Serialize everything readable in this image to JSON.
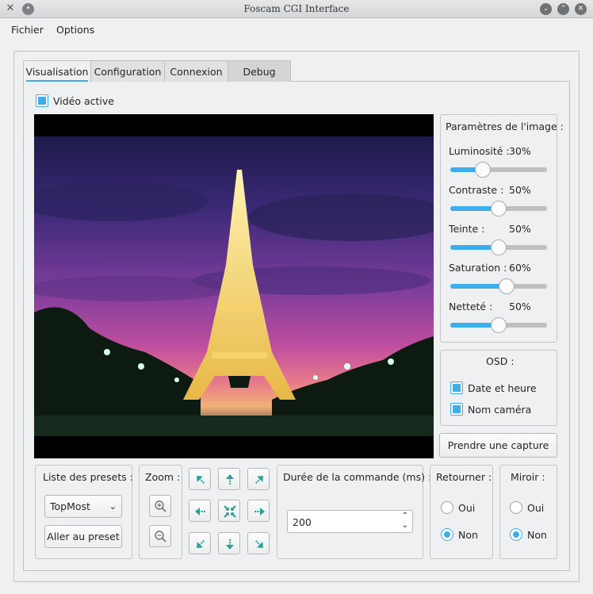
{
  "window": {
    "title": "Foscam CGI Interface"
  },
  "menu": {
    "items": [
      "Fichier",
      "Options"
    ]
  },
  "tabs": [
    "Visualisation",
    "Configuration",
    "Connexion",
    "Debug"
  ],
  "video": {
    "checkbox_label": "Vidéo active",
    "checked": true
  },
  "image_params": {
    "title": "Paramètres de l'image :",
    "sliders": [
      {
        "label": "Luminosité :",
        "value": "30%",
        "level": 0.3
      },
      {
        "label": "Contraste :",
        "value": "50%",
        "level": 0.5
      },
      {
        "label": "Teinte :",
        "value": "50%",
        "level": 0.5
      },
      {
        "label": "Saturation :",
        "value": "60%",
        "level": 0.6
      },
      {
        "label": "Netteté :",
        "value": "50%",
        "level": 0.5
      }
    ]
  },
  "osd": {
    "title": "OSD :",
    "options": [
      {
        "label": "Date et heure",
        "checked": true
      },
      {
        "label": "Nom caméra",
        "checked": true
      }
    ]
  },
  "capture_button": "Prendre une capture",
  "presets": {
    "title": "Liste des presets :",
    "selected": "TopMost",
    "goto_label": "Aller au preset"
  },
  "zoom": {
    "title": "Zoom :"
  },
  "duration": {
    "title": "Durée de la commande (ms) :",
    "value": "200"
  },
  "flip": {
    "title": "Retourner :",
    "options": [
      "Oui",
      "Non"
    ],
    "selected": "Non"
  },
  "mirror": {
    "title": "Miroir :",
    "options": [
      "Oui",
      "Non"
    ],
    "selected": "Non"
  },
  "colors": {
    "accent": "#3daee9",
    "background": "#eff0f1"
  }
}
